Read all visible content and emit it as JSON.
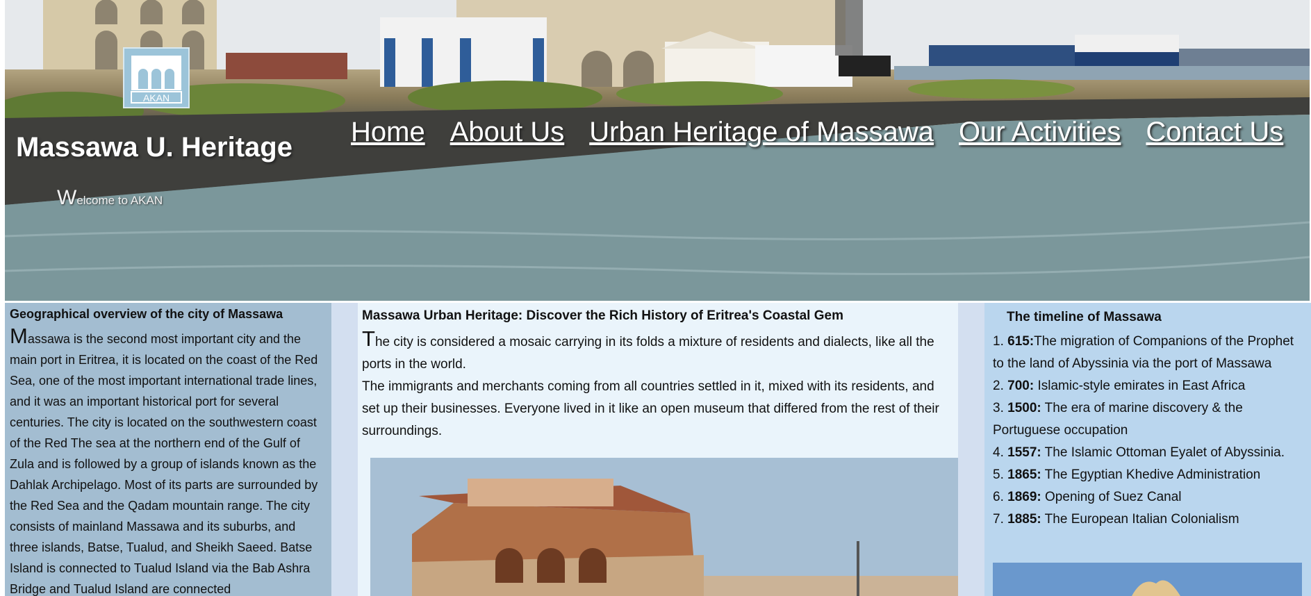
{
  "header": {
    "site_title": "Massawa U. Heritage",
    "welcome_first_letter": "W",
    "welcome_rest": "elcome to AKAN",
    "logo_text": "AKAN"
  },
  "nav": {
    "items": [
      {
        "label": "Home"
      },
      {
        "label": "About Us"
      },
      {
        "label": "Urban Heritage of Massawa"
      },
      {
        "label": "Our Activities"
      },
      {
        "label": "Contact Us"
      }
    ]
  },
  "left": {
    "title": "Geographical overview of the city of Massawa",
    "first_letter": "M",
    "text": "assawa is the second most important city and the main port in Eritrea, it is located on the coast of the Red Sea, one of the most important international trade lines, and it was an important historical port for several centuries. The city is located on the southwestern coast of the Red The sea at the northern end of the Gulf of Zula and is followed by a group of islands known as the Dahlak Archipelago. Most of its parts are surrounded by the Red Sea and the Qadam mountain range. The city consists of mainland Massawa and its suburbs, and three islands, Batse, Tualud, and Sheikh Saeed. Batse Island is connected to Tualud Island via the Bab Ashra Bridge and Tualud Island are connected"
  },
  "middle": {
    "title": "Massawa Urban Heritage: Discover the Rich History of Eritrea's Coastal Gem",
    "first_letter": "T",
    "paragraph1": "he city is considered a mosaic carrying in its folds a mixture of residents and dialects, like all the ports in the world.",
    "paragraph2": "The immigrants and merchants coming from all countries settled in it, mixed with its residents, and set up their businesses. Everyone lived in it like an open museum that differed from the rest of their surroundings."
  },
  "right": {
    "title": "The timeline of Massawa",
    "items": [
      {
        "num": "1.",
        "year": "615:",
        "text": "The migration of Companions of the Prophet to the land of Abyssinia via the port of Massawa"
      },
      {
        "num": "2.",
        "year": "700:",
        "text": " Islamic-style emirates in East Africa"
      },
      {
        "num": "3.",
        "year": "1500:",
        "text": " The era of marine discovery & the Portuguese occupation"
      },
      {
        "num": "4.",
        "year": "1557:",
        "text": " The Islamic Ottoman Eyalet of Abyssinia."
      },
      {
        "num": "5.",
        "year": "1865:",
        "text": " The Egyptian Khedive Administration"
      },
      {
        "num": "6.",
        "year": "1869:",
        "text": " Opening of Suez Canal"
      },
      {
        "num": "7.",
        "year": "1885:",
        "text": " The European Italian Colonialism"
      }
    ]
  }
}
